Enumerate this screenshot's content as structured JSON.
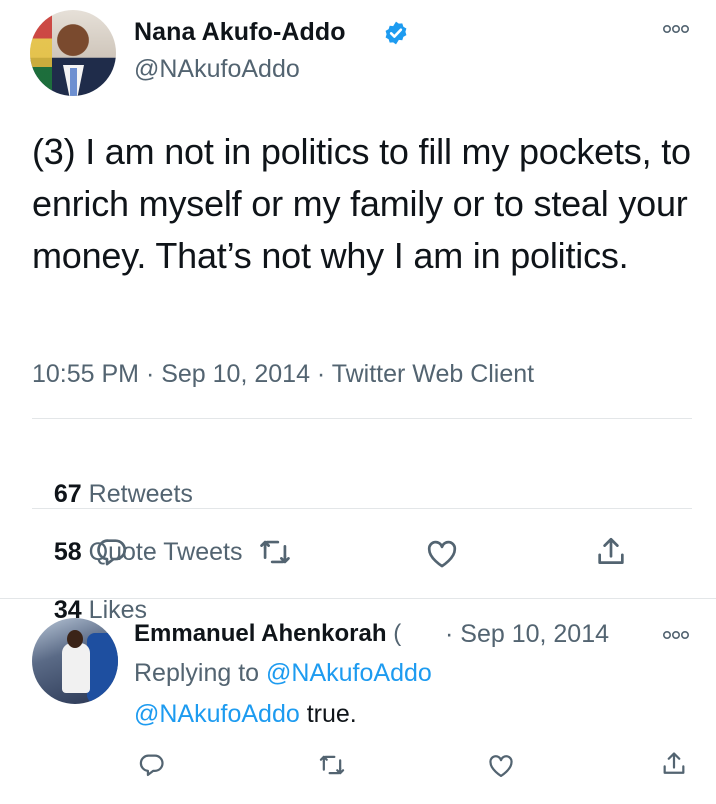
{
  "tweet": {
    "author_name": "Nana Akufo-Addo",
    "author_handle": "@NAkufoAddo",
    "text": "(3) I am not in politics to fill my pockets, to enrich myself or my family or to steal your money. That’s not why I am in politics.",
    "meta": "10:55 PM · Sep 10, 2014 · Twitter Web Client",
    "stats": {
      "retweets_count": "67",
      "retweets_label": "Retweets",
      "quotes_count": "58",
      "quotes_label": "Quote Tweets",
      "likes_count": "34",
      "likes_label": "Likes"
    },
    "icons": [
      "reply-icon",
      "retweet-icon",
      "like-icon",
      "share-icon",
      "verified-icon",
      "more-icon"
    ]
  },
  "reply": {
    "author_name": "Emmanuel Ahenkorah",
    "truncation": "(",
    "date": "· Sep 10, 2014",
    "replying_prefix": "Replying to",
    "replying_handle": "@NAkufoAddo",
    "mention": "@NAkufoAddo",
    "text": "true."
  },
  "colors": {
    "accent": "#1d9bf0",
    "secondary_text": "#536471",
    "primary_text": "#0f1419",
    "divider": "#e3e6e8"
  }
}
